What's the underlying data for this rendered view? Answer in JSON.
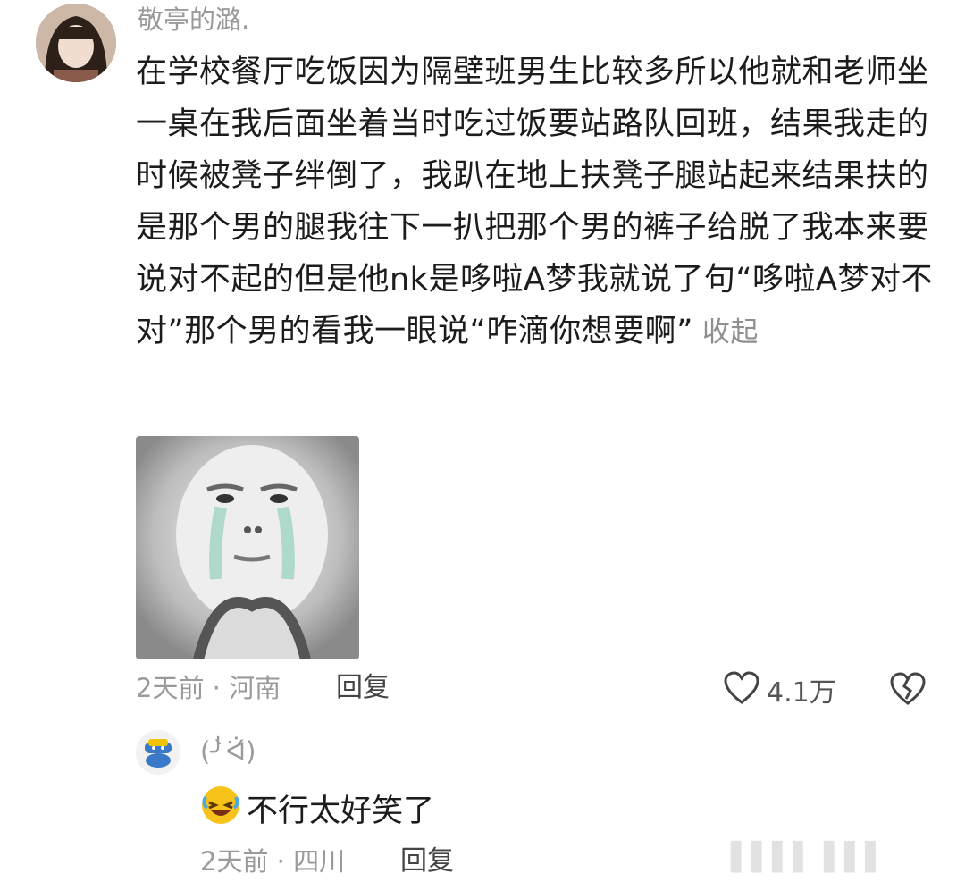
{
  "comment": {
    "username": "敬亭的潞.",
    "text": "在学校餐厅吃饭因为隔壁班男生比较多所以他就和老师坐一桌在我后面坐着当时吃过饭要站路队回班，结果我走的时候被凳子绊倒了，我趴在地上扶凳子腿站起来结果扶的是那个男的腿我往下一扒把那个男的裤子给脱了我本来要说对不起的但是他nk是哆啦A梦我就说了句“哆啦A梦对不对”那个男的看我一眼说“咋滴你想要啊”",
    "collapse_label": "收起",
    "meta": "2天前 · 河南",
    "reply_label": "回复",
    "like_count": "4.1万",
    "icons": {
      "like": "heart-icon",
      "dislike": "broken-heart-icon"
    }
  },
  "reply": {
    "username": "(╯̀ᐛ́)",
    "text": "不行太好笑了",
    "emoji": "rolling-laughing-emoji",
    "meta": "2天前 · 四川",
    "reply_label": "回复"
  },
  "watermark": "▌▌▌▌▐▐▐"
}
